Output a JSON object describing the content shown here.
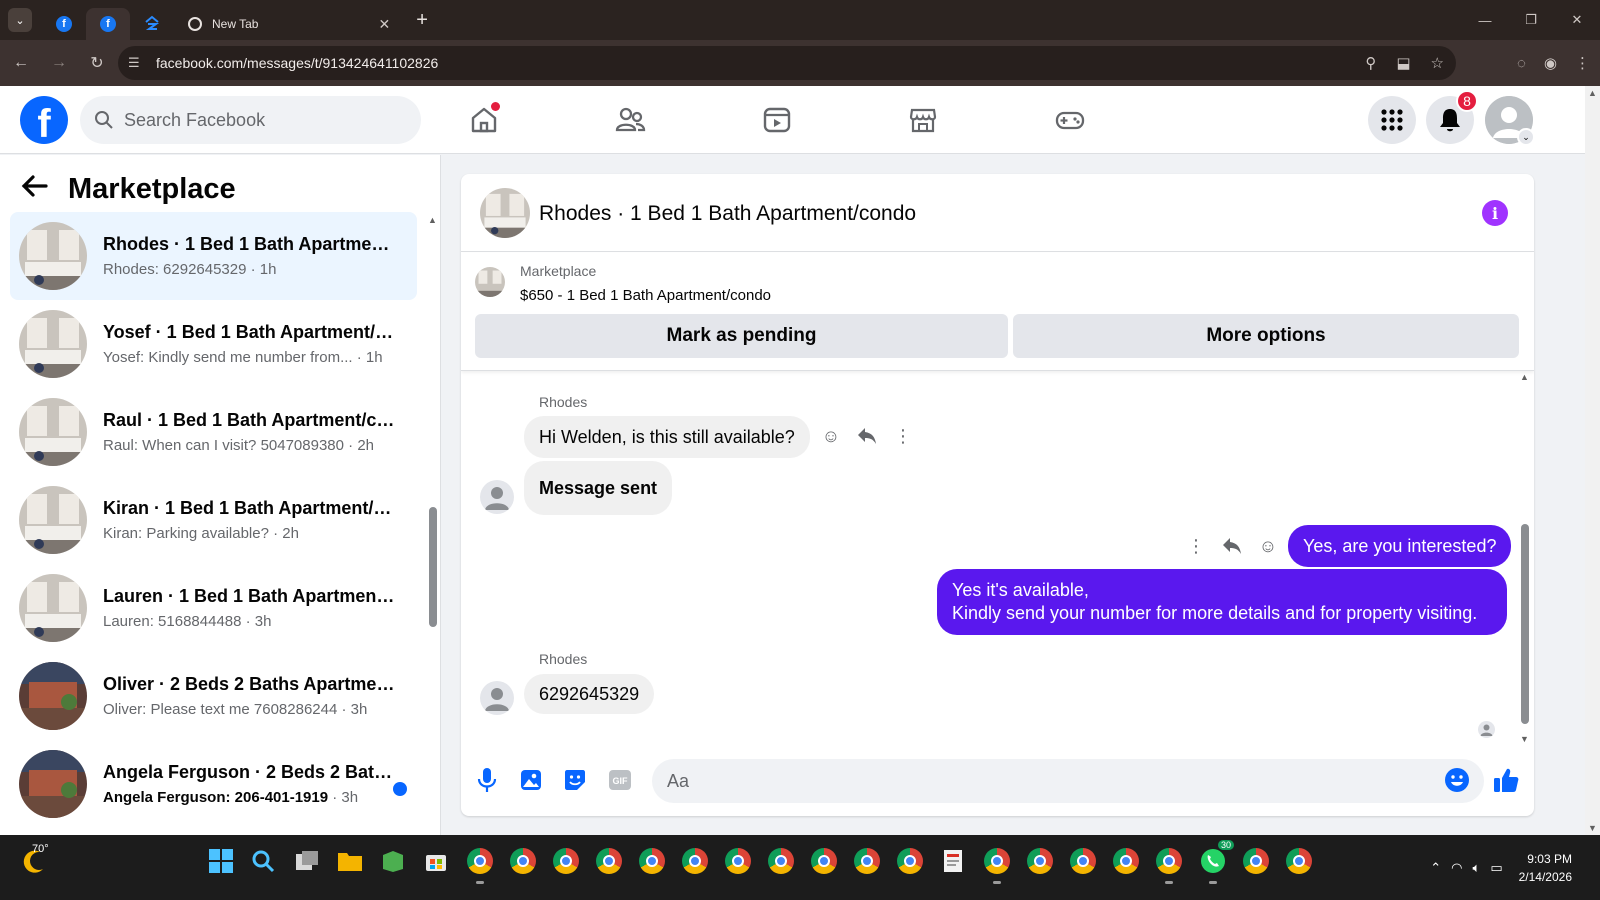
{
  "browser": {
    "tabs": [
      {
        "label": "",
        "icon": "facebook-icon"
      },
      {
        "label": "",
        "icon": "facebook-icon"
      },
      {
        "label": "",
        "icon": "zillow-icon"
      },
      {
        "label": "New Tab",
        "icon": "chrome-icon"
      }
    ],
    "url": "facebook.com/messages/t/913424641102826"
  },
  "header": {
    "search_placeholder": "Search Facebook",
    "notifications_count": "8",
    "nav_icons": [
      "home-icon",
      "friends-icon",
      "video-icon",
      "marketplace-icon",
      "gaming-icon"
    ]
  },
  "sidebar": {
    "title": "Marketplace",
    "conversations": [
      {
        "title": "Rhodes · 1 Bed 1 Bath Apartment/condo",
        "preview": "Rhodes: 6292645329 · 1h",
        "selected": true,
        "unread": false
      },
      {
        "title": "Yosef · 1 Bed 1 Bath Apartment/condo",
        "preview": "Yosef: Kindly send me number from... · 1h",
        "selected": false,
        "unread": false
      },
      {
        "title": "Raul · 1 Bed 1 Bath Apartment/condo",
        "preview": "Raul: When can I visit? 5047089380 · 2h",
        "selected": false,
        "unread": false
      },
      {
        "title": "Kiran · 1 Bed 1 Bath Apartment/condo",
        "preview": "Kiran: Parking available? · 2h",
        "selected": false,
        "unread": false
      },
      {
        "title": "Lauren · 1 Bed 1 Bath Apartment/condo",
        "preview": "Lauren: 5168844488 · 3h",
        "selected": false,
        "unread": false
      },
      {
        "title": "Oliver · 2 Beds 2 Baths Apartment/condo",
        "preview": "Oliver: Please text me 7608286244 · 3h",
        "selected": false,
        "unread": false
      },
      {
        "title": "Angela Ferguson · 2 Beds 2 Baths Apartment/condo",
        "preview": "Angela Ferguson: 206-401-1919",
        "preview_time": "· 3h",
        "selected": false,
        "unread": true
      }
    ]
  },
  "chat": {
    "title": "Rhodes · 1 Bed 1 Bath Apartment/condo",
    "marketplace_label": "Marketplace",
    "listing": "$650 - 1 Bed 1 Bath Apartment/condo",
    "mark_pending_label": "Mark as pending",
    "more_options_label": "More options",
    "messages": [
      {
        "sender": "Rhodes",
        "text": "Hi Welden, is this still available?",
        "direction": "in"
      },
      {
        "text": "Message sent",
        "direction": "in"
      },
      {
        "text": "Yes, are you interested?",
        "direction": "out"
      },
      {
        "lines": [
          "Yes it's available,",
          "Kindly send your number for more details and for property visiting."
        ],
        "direction": "out"
      },
      {
        "sender": "Rhodes",
        "text": "6292645329",
        "direction": "in"
      }
    ],
    "composer_placeholder": "Aa"
  },
  "taskbar": {
    "weather_temp": "70°",
    "whatsapp_badge": "30",
    "time": "9:03 PM",
    "date": "2/14/2026"
  },
  "colors": {
    "fb_blue": "#0866ff",
    "outgoing_bubble": "#5a18ee",
    "info_purple": "#a033ff",
    "notif_red": "#e41e3f"
  }
}
